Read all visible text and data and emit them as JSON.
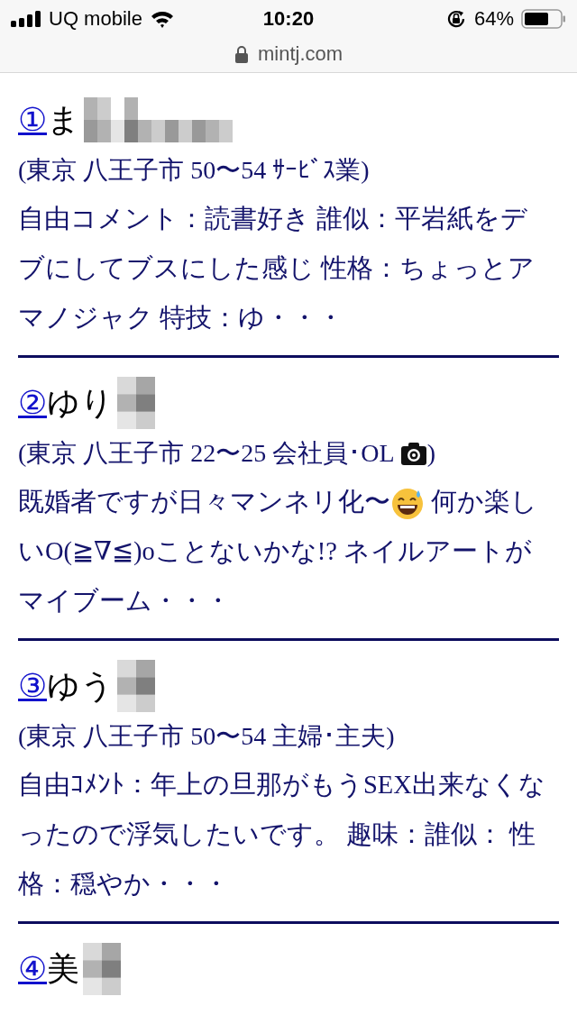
{
  "status_bar": {
    "carrier": "UQ mobile",
    "time": "10:20",
    "battery": "64%"
  },
  "address_bar": {
    "url": "mintj.com"
  },
  "entries": [
    {
      "number": "①",
      "name": "ま",
      "redacted": true,
      "kind": "wide",
      "info": "(東京 八王子市 50〜54 ｻｰﾋﾞｽ業)",
      "photo": false,
      "comment": [
        {
          "kind": "text",
          "text": "自由コメント：読書好き 誰似：平岩紙をデブにしてブスにした感じ 性格：ちょっとアマノジャク 特技：ゆ・・・"
        }
      ]
    },
    {
      "number": "②",
      "name": "ゆり",
      "redacted": true,
      "kind": "narrow",
      "info": "(東京 八王子市 22〜25 会社員･OL",
      "photo": true,
      "info_close": ")",
      "comment": [
        {
          "kind": "text",
          "text": "既婚者ですが日々マンネリ化〜"
        },
        {
          "kind": "emoji"
        },
        {
          "kind": "text",
          "text": " 何か楽しいO(≧∇≦)oことないかな!? ネイルアートがマイブーム・・・"
        }
      ]
    },
    {
      "number": "③",
      "name": "ゆう",
      "redacted": true,
      "kind": "narrow",
      "info": "(東京 八王子市 50〜54 主婦･主夫)",
      "photo": false,
      "comment": [
        {
          "kind": "text",
          "text": "自由ｺﾒﾝﾄ：年上の旦那がもうSEX出来なくなったので浮気したいです。 趣味：誰似： 性格：穏やか・・・"
        }
      ]
    },
    {
      "number": "④",
      "name": "美",
      "redacted": true,
      "kind": "narrow"
    }
  ]
}
